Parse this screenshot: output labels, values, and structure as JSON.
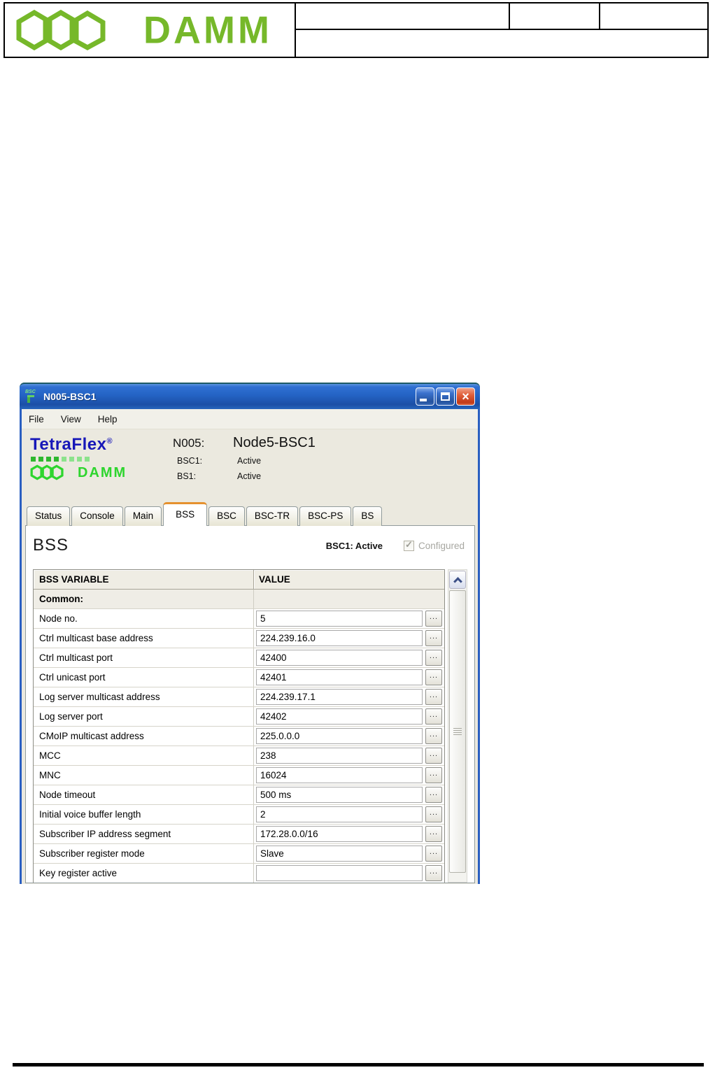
{
  "page_header": {
    "brand": "DAMM"
  },
  "window": {
    "title": "N005-BSC1",
    "menu": [
      "File",
      "View",
      "Help"
    ],
    "brand": {
      "product": "TetraFlex",
      "reg_mark": "®",
      "company": "DAMM"
    },
    "node": {
      "id": "N005:",
      "name": "Node5-BSC1",
      "status_rows": [
        {
          "label": "BSC1:",
          "value": "Active"
        },
        {
          "label": "BS1:",
          "value": "Active"
        }
      ]
    },
    "tabs": [
      {
        "label": "Status",
        "active": false
      },
      {
        "label": "Console",
        "active": false
      },
      {
        "label": "Main",
        "active": false
      },
      {
        "label": "BSS",
        "active": true
      },
      {
        "label": "BSC",
        "active": false
      },
      {
        "label": "BSC-TR",
        "active": false
      },
      {
        "label": "BSC-PS",
        "active": false
      },
      {
        "label": "BS",
        "active": false
      }
    ],
    "panel": {
      "heading": "BSS",
      "status": "BSC1: Active",
      "configured": {
        "label": "Configured",
        "checked": true,
        "enabled": false
      },
      "table": {
        "col_variable": "BSS VARIABLE",
        "col_value": "VALUE",
        "section_header": "Common:",
        "edit_button_label": "...",
        "rows": [
          {
            "label": "Node no.",
            "value": "5"
          },
          {
            "label": "Ctrl multicast base address",
            "value": "224.239.16.0"
          },
          {
            "label": "Ctrl multicast port",
            "value": "42400"
          },
          {
            "label": "Ctrl unicast port",
            "value": "42401"
          },
          {
            "label": "Log server multicast address",
            "value": "224.239.17.1"
          },
          {
            "label": "Log server port",
            "value": "42402"
          },
          {
            "label": "CMoIP multicast address",
            "value": "225.0.0.0"
          },
          {
            "label": "MCC",
            "value": "238"
          },
          {
            "label": "MNC",
            "value": "16024"
          },
          {
            "label": "Node timeout",
            "value": "500 ms"
          },
          {
            "label": "Initial voice buffer length",
            "value": "2"
          },
          {
            "label": "Subscriber IP address segment",
            "value": "172.28.0.0/16"
          },
          {
            "label": "Subscriber register mode",
            "value": "Slave"
          },
          {
            "label": "Key register active",
            "value": ""
          }
        ]
      }
    },
    "colors": {
      "titlebar_blue": "#2463c4",
      "tetraflex_blue": "#1717b8",
      "damm_bright_green": "#2ed52e",
      "damm_logo_green": "#76b82a",
      "active_tab_accent": "#e5912e"
    }
  }
}
